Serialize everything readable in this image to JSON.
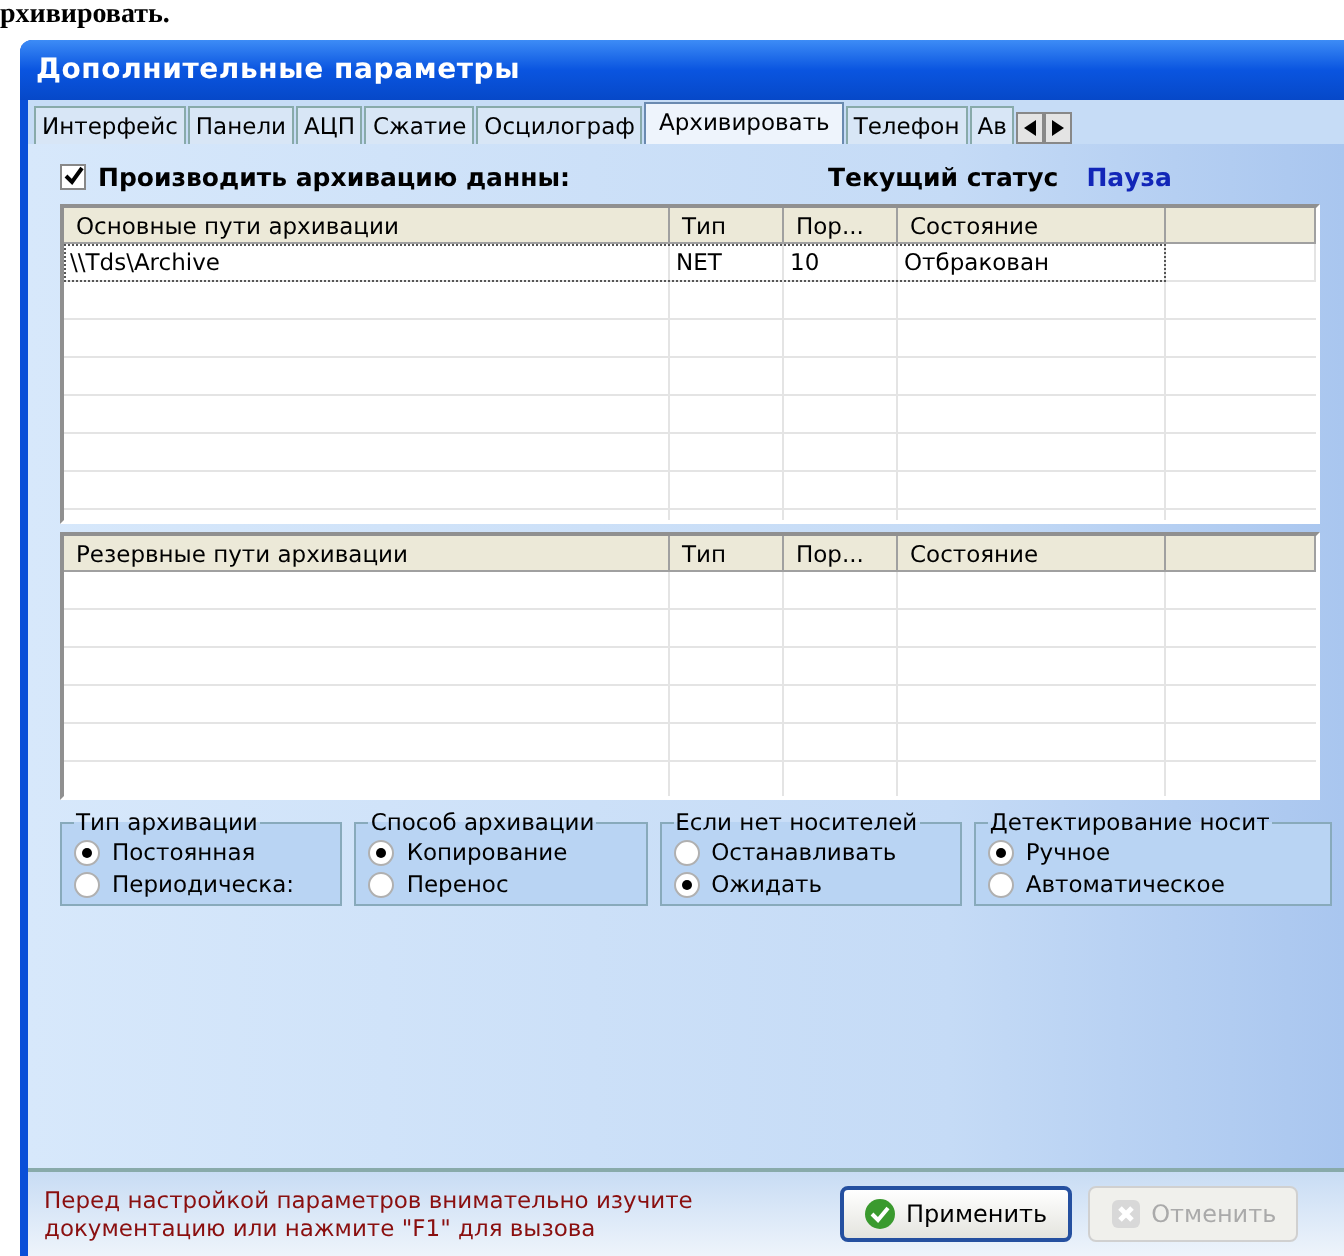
{
  "caption": "рхивировать.",
  "window": {
    "title": "Дополнительные параметры"
  },
  "tabs": [
    {
      "label": "Интерфейс",
      "selected": false
    },
    {
      "label": "Панели",
      "selected": false
    },
    {
      "label": "АЦП",
      "selected": false
    },
    {
      "label": "Сжатие",
      "selected": false
    },
    {
      "label": "Осцилограф",
      "selected": false
    },
    {
      "label": "Архивировать",
      "selected": true
    },
    {
      "label": "Телефон",
      "selected": false
    },
    {
      "label": "Ав",
      "selected": false
    }
  ],
  "archive_toggle": {
    "label": "Производить архивацию данны:",
    "checked": true
  },
  "status": {
    "label": "Текущий статус",
    "value": "Пауза"
  },
  "tables": [
    {
      "columns": [
        "Основные пути архивации",
        "Тип",
        "Пор...",
        "Состояние"
      ],
      "rows": [
        [
          "\\\\Tds\\Archive",
          "NET",
          "10",
          "Отбракован"
        ]
      ]
    },
    {
      "columns": [
        "Резервные пути архивации",
        "Тип",
        "Пор...",
        "Состояние"
      ]
    }
  ],
  "groups": [
    {
      "title": "Тип архивации",
      "options": [
        {
          "label": "Постоянная",
          "selected": true
        },
        {
          "label": "Периодическа:",
          "selected": false
        }
      ]
    },
    {
      "title": "Способ архивации",
      "options": [
        {
          "label": "Копирование",
          "selected": true
        },
        {
          "label": "Перенос",
          "selected": false
        }
      ]
    },
    {
      "title": "Если нет носителей",
      "options": [
        {
          "label": "Останавливать",
          "selected": false
        },
        {
          "label": "Ожидать",
          "selected": true
        }
      ]
    },
    {
      "title": "Детектирование носит",
      "options": [
        {
          "label": "Ручное",
          "selected": true
        },
        {
          "label": "Автоматическое",
          "selected": false
        }
      ]
    }
  ],
  "footer": {
    "note": "Перед настройкой параметров внимательно изучите документацию или нажмите \"F1\" для вызова",
    "buttons": [
      {
        "label": "Применить",
        "disabled": false
      },
      {
        "label": "Отменить",
        "disabled": true
      }
    ]
  }
}
